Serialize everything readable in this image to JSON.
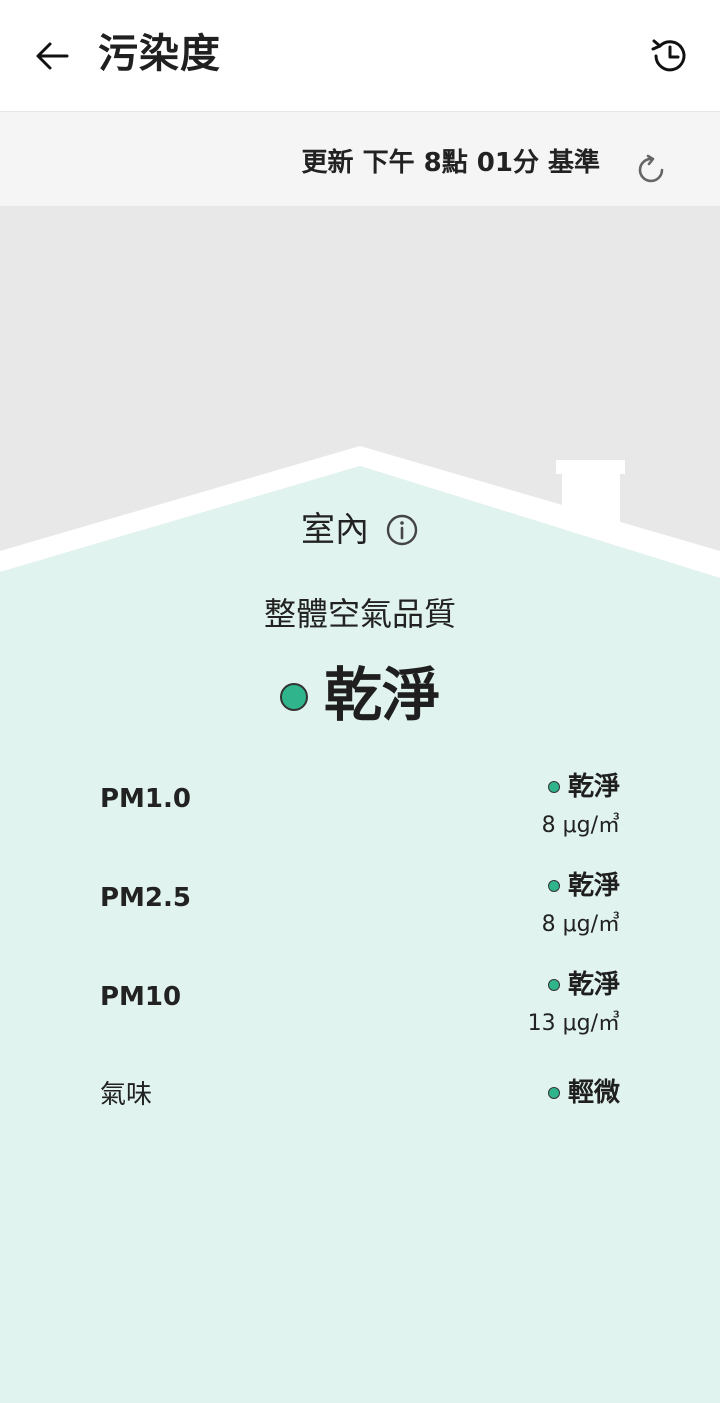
{
  "header": {
    "title": "污染度",
    "back_icon": "arrow-left-icon",
    "history_icon": "history-clock-icon"
  },
  "update": {
    "text": "更新 下午 8點 01分 基準",
    "refresh_icon": "refresh-icon"
  },
  "indoor": {
    "location_label": "室內",
    "info_icon": "info-icon"
  },
  "overall": {
    "label": "整體空氣品質",
    "status": "乾淨"
  },
  "metrics": [
    {
      "name": "PM1.0",
      "status": "乾淨",
      "value": "8 μg/㎥"
    },
    {
      "name": "PM2.5",
      "status": "乾淨",
      "value": "8 μg/㎥"
    },
    {
      "name": "PM10",
      "status": "乾淨",
      "value": "13 μg/㎥"
    },
    {
      "name": "氣味",
      "status": "輕微"
    }
  ],
  "colors": {
    "good": "#2fb48c",
    "house_fill": "#e0f3ee",
    "sky": "#e8e8e8"
  }
}
